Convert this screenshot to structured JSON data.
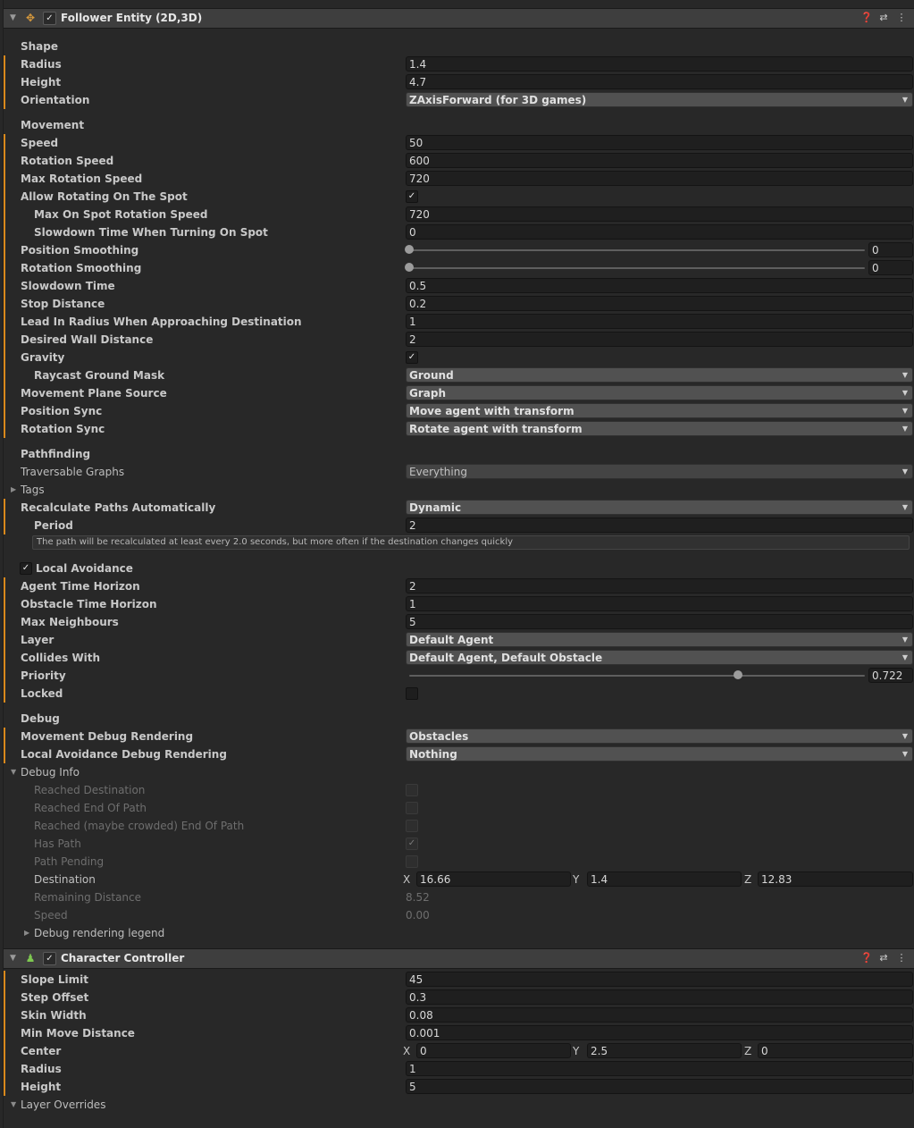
{
  "follower": {
    "title": "Follower Entity (2D,3D)",
    "enabled": true,
    "icon": "follower-entity-icon",
    "shape": {
      "section": "Shape",
      "radius": {
        "label": "Radius",
        "value": "1.4"
      },
      "height": {
        "label": "Height",
        "value": "4.7"
      },
      "orientation": {
        "label": "Orientation",
        "value": "ZAxisForward (for 3D games)"
      }
    },
    "movement": {
      "section": "Movement",
      "speed": {
        "label": "Speed",
        "value": "50"
      },
      "rotation_speed": {
        "label": "Rotation Speed",
        "value": "600"
      },
      "max_rotation_speed": {
        "label": "Max Rotation Speed",
        "value": "720"
      },
      "allow_rotating": {
        "label": "Allow Rotating On The Spot",
        "checked": true
      },
      "max_on_spot": {
        "label": "Max On Spot Rotation Speed",
        "value": "720"
      },
      "slowdown_turning": {
        "label": "Slowdown Time When Turning On Spot",
        "value": "0"
      },
      "position_smoothing": {
        "label": "Position Smoothing",
        "value": "0",
        "fraction": 0
      },
      "rotation_smoothing": {
        "label": "Rotation Smoothing",
        "value": "0",
        "fraction": 0
      },
      "slowdown_time": {
        "label": "Slowdown Time",
        "value": "0.5"
      },
      "stop_distance": {
        "label": "Stop Distance",
        "value": "0.2"
      },
      "lead_in": {
        "label": "Lead In Radius When Approaching Destination",
        "value": "1"
      },
      "wall_distance": {
        "label": "Desired Wall Distance",
        "value": "2"
      },
      "gravity": {
        "label": "Gravity",
        "checked": true
      },
      "raycast_mask": {
        "label": "Raycast Ground Mask",
        "value": "Ground"
      },
      "plane_source": {
        "label": "Movement Plane Source",
        "value": "Graph"
      },
      "position_sync": {
        "label": "Position Sync",
        "value": "Move agent with transform"
      },
      "rotation_sync": {
        "label": "Rotation Sync",
        "value": "Rotate agent with transform"
      }
    },
    "pathfinding": {
      "section": "Pathfinding",
      "traversable": {
        "label": "Traversable Graphs",
        "value": "Everything"
      },
      "tags": {
        "label": "Tags"
      },
      "recalc": {
        "label": "Recalculate Paths Automatically",
        "value": "Dynamic"
      },
      "period": {
        "label": "Period",
        "value": "2"
      },
      "help": "The path will be recalculated at least every 2.0 seconds, but more often if the destination changes quickly"
    },
    "avoidance": {
      "section": "Local Avoidance",
      "enabled": true,
      "time_horizon": {
        "label": "Agent Time Horizon",
        "value": "2"
      },
      "obstacle_horizon": {
        "label": "Obstacle Time Horizon",
        "value": "1"
      },
      "max_neighbours": {
        "label": "Max Neighbours",
        "value": "5"
      },
      "layer": {
        "label": "Layer",
        "value": "Default Agent"
      },
      "collides_with": {
        "label": "Collides With",
        "value": "Default Agent, Default Obstacle"
      },
      "priority": {
        "label": "Priority",
        "value": "0.722",
        "fraction": 0.722
      },
      "locked": {
        "label": "Locked",
        "checked": false
      }
    },
    "debug": {
      "section": "Debug",
      "movement_rendering": {
        "label": "Movement Debug Rendering",
        "value": "Obstacles"
      },
      "avoidance_rendering": {
        "label": "Local Avoidance Debug Rendering",
        "value": "Nothing"
      },
      "info": {
        "label": "Debug Info"
      },
      "reached_destination": {
        "label": "Reached Destination",
        "checked": false
      },
      "reached_end": {
        "label": "Reached End Of Path",
        "checked": false
      },
      "reached_crowded": {
        "label": "Reached (maybe crowded) End Of Path",
        "checked": false
      },
      "has_path": {
        "label": "Has Path",
        "checked": true
      },
      "path_pending": {
        "label": "Path Pending",
        "checked": false
      },
      "destination": {
        "label": "Destination",
        "x_label": "X",
        "y_label": "Y",
        "z_label": "Z",
        "x": "16.66",
        "y": "1.4",
        "z": "12.83"
      },
      "remaining": {
        "label": "Remaining Distance",
        "value": "8.52"
      },
      "speed": {
        "label": "Speed",
        "value": "0.00"
      },
      "legend": {
        "label": "Debug rendering legend"
      }
    }
  },
  "controller": {
    "title": "Character Controller",
    "enabled": true,
    "icon": "character-controller-icon",
    "slope_limit": {
      "label": "Slope Limit",
      "value": "45"
    },
    "step_offset": {
      "label": "Step Offset",
      "value": "0.3"
    },
    "skin_width": {
      "label": "Skin Width",
      "value": "0.08"
    },
    "min_move": {
      "label": "Min Move Distance",
      "value": "0.001"
    },
    "center": {
      "label": "Center",
      "x_label": "X",
      "y_label": "Y",
      "z_label": "Z",
      "x": "0",
      "y": "2.5",
      "z": "0"
    },
    "radius": {
      "label": "Radius",
      "value": "1"
    },
    "height": {
      "label": "Height",
      "value": "5"
    },
    "layer_overrides": {
      "label": "Layer Overrides"
    }
  },
  "colors": {
    "accent_override": "#d9891c",
    "background": "#282828",
    "header": "#3e3e3e"
  }
}
